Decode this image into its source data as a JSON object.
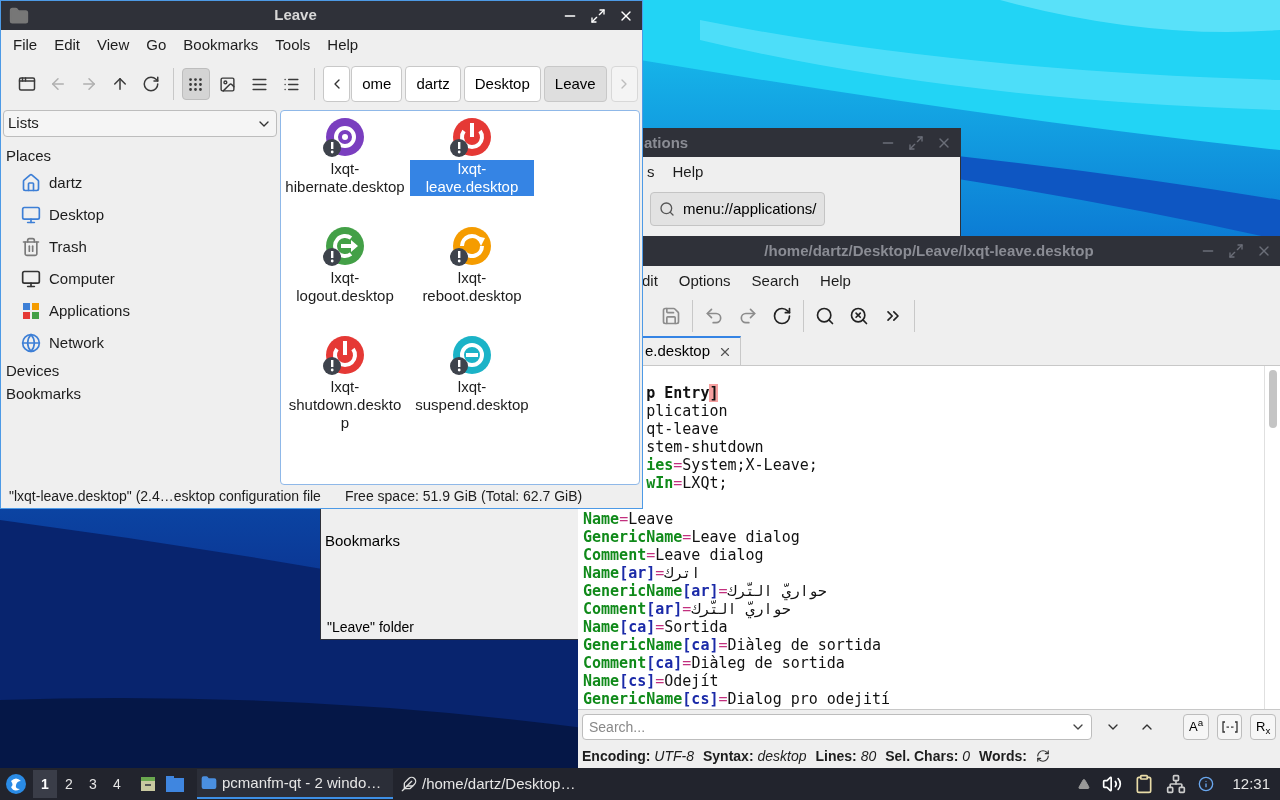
{
  "file_manager": {
    "title": "Leave",
    "menu": [
      "File",
      "Edit",
      "View",
      "Go",
      "Bookmarks",
      "Tools",
      "Help"
    ],
    "toolbar": [
      {
        "kind": "new-window",
        "disabled": false
      },
      {
        "kind": "back",
        "disabled": true
      },
      {
        "kind": "forward",
        "disabled": true
      },
      {
        "kind": "up",
        "disabled": false
      },
      {
        "kind": "reload",
        "disabled": false
      }
    ],
    "view_modes": [
      {
        "kind": "icons",
        "selected": true
      },
      {
        "kind": "thumbnails",
        "selected": false
      },
      {
        "kind": "compact",
        "selected": false
      },
      {
        "kind": "details",
        "selected": false
      }
    ],
    "path": [
      {
        "label": "ome",
        "selected": false
      },
      {
        "label": "dartz",
        "selected": false
      },
      {
        "label": "Desktop",
        "selected": false
      },
      {
        "label": "Leave",
        "selected": true
      }
    ],
    "path_next": {
      "disabled": true
    },
    "side_pane": {
      "mode": "Lists",
      "places_heading": "Places",
      "places": [
        {
          "label": "dartz",
          "kind": "home"
        },
        {
          "label": "Desktop",
          "kind": "desktop"
        },
        {
          "label": "Trash",
          "kind": "trash"
        },
        {
          "label": "Computer",
          "kind": "computer"
        },
        {
          "label": "Applications",
          "kind": "applications"
        },
        {
          "label": "Network",
          "kind": "network"
        }
      ],
      "other_headings": [
        "Devices",
        "Bookmarks"
      ]
    },
    "files": [
      {
        "name": "lxqt-hibernate.desktop",
        "kind": "hibernate",
        "color": "#7a3ebf",
        "selected": false
      },
      {
        "name": "lxqt-leave.desktop",
        "kind": "power",
        "color": "#e53935",
        "selected": true
      },
      {
        "name": "lxqt-logout.desktop",
        "kind": "logout",
        "color": "#43a047",
        "selected": false
      },
      {
        "name": "lxqt-reboot.desktop",
        "kind": "reboot",
        "color": "#f59c00",
        "selected": false
      },
      {
        "name": "lxqt-shutdown.desktop",
        "kind": "power",
        "color": "#e53935",
        "selected": false
      },
      {
        "name": "lxqt-suspend.desktop",
        "kind": "suspend",
        "color": "#1bb3c7",
        "selected": false
      }
    ],
    "status": [
      "\"lxqt-leave.desktop\" (2.4…esktop configuration file",
      "Free space: 51.9 GiB (Total: 62.7 GiB)"
    ]
  },
  "back_window": {
    "title": "ations",
    "menu": [
      "s",
      "Help"
    ],
    "location": "menu://applications/",
    "side_pane_heading": "Bookmarks",
    "status": "\"Leave\" folder"
  },
  "editor": {
    "title": "/home/dartz/Desktop/Leave/lxqt-leave.desktop",
    "menu": [
      "dit",
      "Options",
      "Search",
      "Help"
    ],
    "toolbar": [
      {
        "kind": "save",
        "disabled": true
      },
      {
        "kind": "undo",
        "disabled": true
      },
      {
        "kind": "redo",
        "disabled": true
      },
      {
        "kind": "reload",
        "disabled": false
      },
      {
        "kind": "find",
        "disabled": false
      },
      {
        "kind": "replace",
        "disabled": false
      },
      {
        "kind": "more",
        "disabled": false
      }
    ],
    "tab": "e.desktop",
    "partial_lines": [
      [
        {
          "t": "p Entry",
          "kind": "section"
        },
        {
          "t": "]",
          "kind": "match"
        }
      ],
      [
        {
          "t": "plication",
          "kind": "value"
        }
      ],
      [
        {
          "t": "qt-leave",
          "kind": "value"
        }
      ],
      [
        {
          "t": "stem-shutdown",
          "kind": "value"
        }
      ],
      [
        {
          "t": "ies",
          "kind": "key"
        },
        {
          "t": "=",
          "kind": "op"
        },
        {
          "t": "System;X-Leave;",
          "kind": "value"
        }
      ],
      [
        {
          "t": "wIn",
          "kind": "key"
        },
        {
          "t": "=",
          "kind": "op"
        },
        {
          "t": "LXQt;",
          "kind": "value"
        }
      ]
    ],
    "lines": [
      [
        {
          "t": "Name",
          "kind": "key"
        },
        {
          "t": "=",
          "kind": "op"
        },
        {
          "t": "Leave",
          "kind": "value"
        }
      ],
      [
        {
          "t": "GenericName",
          "kind": "key"
        },
        {
          "t": "=",
          "kind": "op"
        },
        {
          "t": "Leave dialog",
          "kind": "value"
        }
      ],
      [
        {
          "t": "Comment",
          "kind": "key"
        },
        {
          "t": "=",
          "kind": "op"
        },
        {
          "t": "Leave dialog",
          "kind": "value"
        }
      ],
      [
        {
          "t": "Name",
          "kind": "key"
        },
        {
          "t": "[ar]",
          "kind": "locale"
        },
        {
          "t": "=",
          "kind": "op"
        },
        {
          "t": "اترك",
          "kind": "value"
        }
      ],
      [
        {
          "t": "GenericName",
          "kind": "key"
        },
        {
          "t": "[ar]",
          "kind": "locale"
        },
        {
          "t": "=",
          "kind": "op"
        },
        {
          "t": "حواريّ التّرك",
          "kind": "value"
        }
      ],
      [
        {
          "t": "Comment",
          "kind": "key"
        },
        {
          "t": "[ar]",
          "kind": "locale"
        },
        {
          "t": "=",
          "kind": "op"
        },
        {
          "t": "حواريّ التّرك",
          "kind": "value"
        }
      ],
      [
        {
          "t": "Name",
          "kind": "key"
        },
        {
          "t": "[ca]",
          "kind": "locale"
        },
        {
          "t": "=",
          "kind": "op"
        },
        {
          "t": "Sortida",
          "kind": "value"
        }
      ],
      [
        {
          "t": "GenericName",
          "kind": "key"
        },
        {
          "t": "[ca]",
          "kind": "locale"
        },
        {
          "t": "=",
          "kind": "op"
        },
        {
          "t": "Diàleg de sortida",
          "kind": "value"
        }
      ],
      [
        {
          "t": "Comment",
          "kind": "key"
        },
        {
          "t": "[ca]",
          "kind": "locale"
        },
        {
          "t": "=",
          "kind": "op"
        },
        {
          "t": "Diàleg de sortida",
          "kind": "value"
        }
      ],
      [
        {
          "t": "Name",
          "kind": "key"
        },
        {
          "t": "[cs]",
          "kind": "locale"
        },
        {
          "t": "=",
          "kind": "op"
        },
        {
          "t": "Odejít",
          "kind": "value"
        }
      ],
      [
        {
          "t": "GenericName",
          "kind": "key"
        },
        {
          "t": "[cs]",
          "kind": "locale"
        },
        {
          "t": "=",
          "kind": "op"
        },
        {
          "t": "Dialog pro odejití",
          "kind": "value"
        }
      ]
    ],
    "search": {
      "placeholder": "Search..."
    },
    "find_options": [
      {
        "kind": "case",
        "label": "A$^{a}$"
      },
      {
        "kind": "whole-word"
      },
      {
        "kind": "regex",
        "label": "R$_{x}$"
      }
    ],
    "status": [
      {
        "label": "Encoding:",
        "value": "UTF-8"
      },
      {
        "label": "Syntax:",
        "value": "desktop"
      },
      {
        "label": "Lines:",
        "value": "80"
      },
      {
        "label": "Sel. Chars:",
        "value": "0"
      },
      {
        "label": "Words:"
      }
    ]
  },
  "taskbar": {
    "desktops": [
      {
        "label": "1",
        "selected": true
      },
      {
        "label": "2",
        "selected": false
      },
      {
        "label": "3",
        "selected": false
      },
      {
        "label": "4",
        "selected": false
      }
    ],
    "tasks": [
      {
        "label": "pcmanfm-qt - 2 windo…",
        "kind": "folder",
        "selected": true
      },
      {
        "label": "/home/dartz/Desktop…",
        "kind": "editor",
        "selected": false
      }
    ],
    "clock": "12:31"
  }
}
